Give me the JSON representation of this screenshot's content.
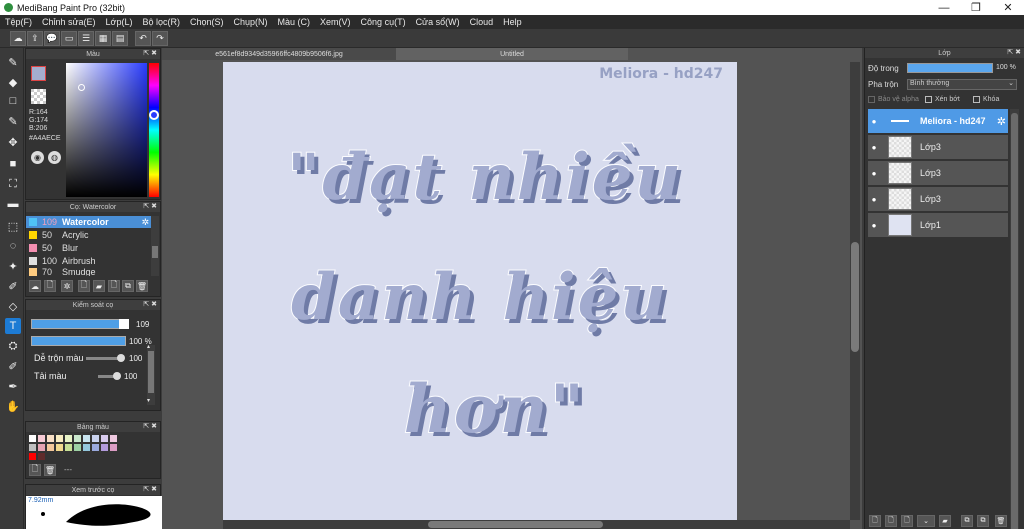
{
  "window": {
    "title": "MediBang Paint Pro (32bit)",
    "minimize_glyph": "—",
    "maximize_glyph": "❐",
    "close_glyph": "✕"
  },
  "menu": [
    "Tệp(F)",
    "Chỉnh sửa(E)",
    "Lớp(L)",
    "Bộ lọc(R)",
    "Chọn(S)",
    "Chụp(N)",
    "Màu (C)",
    "Xem(V)",
    "Công cụ(T)",
    "Cửa sổ(W)",
    "Cloud",
    "Help"
  ],
  "toolbar": {
    "icons": [
      "cloud-icon",
      "cloud-upload-icon",
      "comment-icon",
      "chat-icon",
      "list-icon",
      "grid-icon",
      "layout-icon",
      "undo-icon",
      "redo-icon"
    ],
    "glyphs": [
      "☁",
      "⇪",
      "💬",
      "▭",
      "☰",
      "▦",
      "▤",
      "↶",
      "↷"
    ]
  },
  "tools": {
    "glyphs": [
      "✎",
      "◆",
      "□",
      "✎",
      "✥",
      "■",
      "⛶",
      "▬",
      "⬚",
      "◌",
      "✦",
      "✐",
      "◇",
      "T",
      "⛭",
      "✐",
      "✒",
      "✋"
    ],
    "active_index": 13
  },
  "color_panel": {
    "title": "Màu",
    "r": "R:164",
    "g": "G:174",
    "b": "B:206",
    "hex": "#A4AECE",
    "primary_color": "#a4aece"
  },
  "brush_panel": {
    "title": "Cọ: Watercolor",
    "brushes": [
      {
        "size": "109",
        "name": "Watercolor",
        "color": "#4fc3f7"
      },
      {
        "size": "50",
        "name": "Acrylic",
        "color": "#ffd600"
      },
      {
        "size": "50",
        "name": "Blur",
        "color": "#f48fb1"
      },
      {
        "size": "100",
        "name": "Airbrush",
        "color": "#e0e0e0"
      },
      {
        "size": "70",
        "name": "Smudge",
        "color": "#ffcc80"
      }
    ]
  },
  "brush_control": {
    "title": "Kiểm soát cọ",
    "size_value": "109",
    "opacity_value": "100 %",
    "mix_label": "Dễ trộn màu",
    "mix_value": "100",
    "load_label": "Tải màu",
    "load_value": "100"
  },
  "palette_panel": {
    "title": "Bảng màu",
    "colors": [
      "#ffffff",
      "#f7cbd5",
      "#f9e0c6",
      "#f8ecc1",
      "#e7f2c6",
      "#c9e7cc",
      "#c8e4ef",
      "#cad3ef",
      "#d8cbee",
      "#efc9e0",
      "#bfbfbf",
      "#e6a3b2",
      "#f3c79a",
      "#f0d88d",
      "#c6df95",
      "#9dd0a4",
      "#94c7dd",
      "#9aa9de",
      "#b39bdd",
      "#dc9cc4",
      "#ff0000",
      "#5f2b2b"
    ],
    "footer": "---"
  },
  "preview_panel": {
    "title": "Xem trước cọ",
    "size": "7.92mm"
  },
  "documents": {
    "tab1": "e561ef8d9349d35966ffc4809b9506f6.jpg",
    "tab2": "Untitled"
  },
  "canvas": {
    "watermark": "Meliora - hd247",
    "line1": "\"đạt nhiều",
    "line2": "danh hiệu",
    "line3": "hơn\""
  },
  "layer_panel": {
    "title": "Lớp",
    "opacity_label": "Độ trong",
    "opacity_value": "100 %",
    "blend_label": "Pha trộn",
    "blend_value": "Bình thường",
    "protect_alpha": "Bảo vệ alpha",
    "clipping": "Xén bớt",
    "lock": "Khóa",
    "layers": [
      {
        "name": "Meliora - hd247",
        "selected": true
      },
      {
        "name": "Lớp3",
        "selected": false
      },
      {
        "name": "Lớp3",
        "selected": false
      },
      {
        "name": "Lớp3",
        "selected": false
      },
      {
        "name": "Lớp1",
        "selected": false
      }
    ]
  },
  "panel_glyphs": {
    "collapse": "⇱",
    "close": "✖",
    "visible": "●",
    "gear": "✲",
    "add_file": "🗋",
    "folder": "▰",
    "trash": "🗑",
    "copy": "⧉",
    "dropdown": "⌄",
    "scroll_up": "▴",
    "scroll_down": "▾"
  }
}
